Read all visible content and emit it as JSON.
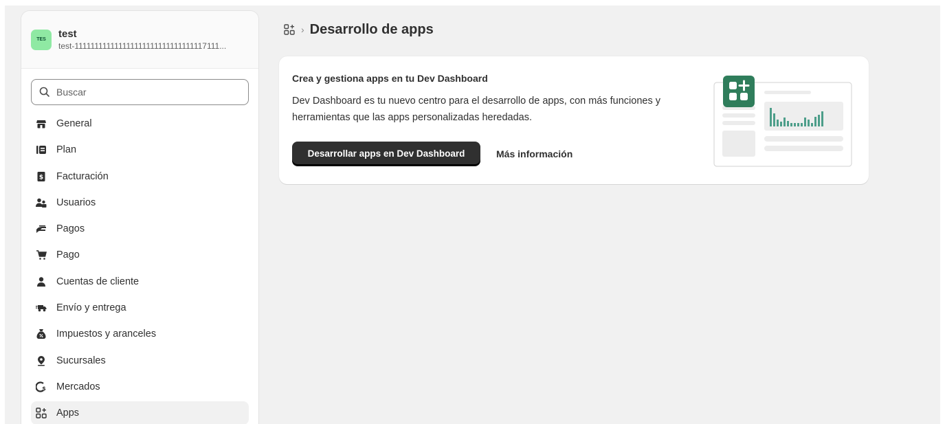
{
  "store": {
    "avatar_text": "TES",
    "name": "test",
    "domain": "test-111111111111111111111111111111117111..."
  },
  "search": {
    "placeholder": "Buscar"
  },
  "sidebar": {
    "items": [
      {
        "label": "General",
        "icon": "store-icon"
      },
      {
        "label": "Plan",
        "icon": "plan-icon"
      },
      {
        "label": "Facturación",
        "icon": "billing-icon"
      },
      {
        "label": "Usuarios",
        "icon": "users-icon"
      },
      {
        "label": "Pagos",
        "icon": "payments-icon"
      },
      {
        "label": "Pago",
        "icon": "checkout-cart-icon"
      },
      {
        "label": "Cuentas de cliente",
        "icon": "person-icon"
      },
      {
        "label": "Envío y entrega",
        "icon": "delivery-truck-icon"
      },
      {
        "label": "Impuestos y aranceles",
        "icon": "tax-bag-icon"
      },
      {
        "label": "Sucursales",
        "icon": "location-pin-icon"
      },
      {
        "label": "Mercados",
        "icon": "globe-currency-icon"
      },
      {
        "label": "Apps",
        "icon": "apps-icon",
        "active": true
      }
    ]
  },
  "breadcrumb": {
    "title": "Desarrollo de apps",
    "separator": "›"
  },
  "card": {
    "title": "Crea y gestiona apps en tu Dev Dashboard",
    "body": "Dev Dashboard es tu nuevo centro para el desarrollo de apps, con más funciones y herramientas que las apps personalizadas heredadas.",
    "primary_label": "Desarrollar apps en Dev Dashboard",
    "secondary_label": "Más información"
  },
  "colors": {
    "accent_green": "#2f7d5b",
    "avatar_bg": "#8fe9a3",
    "bar_teal": "#4d9e8a",
    "primary_button": "#303030"
  }
}
